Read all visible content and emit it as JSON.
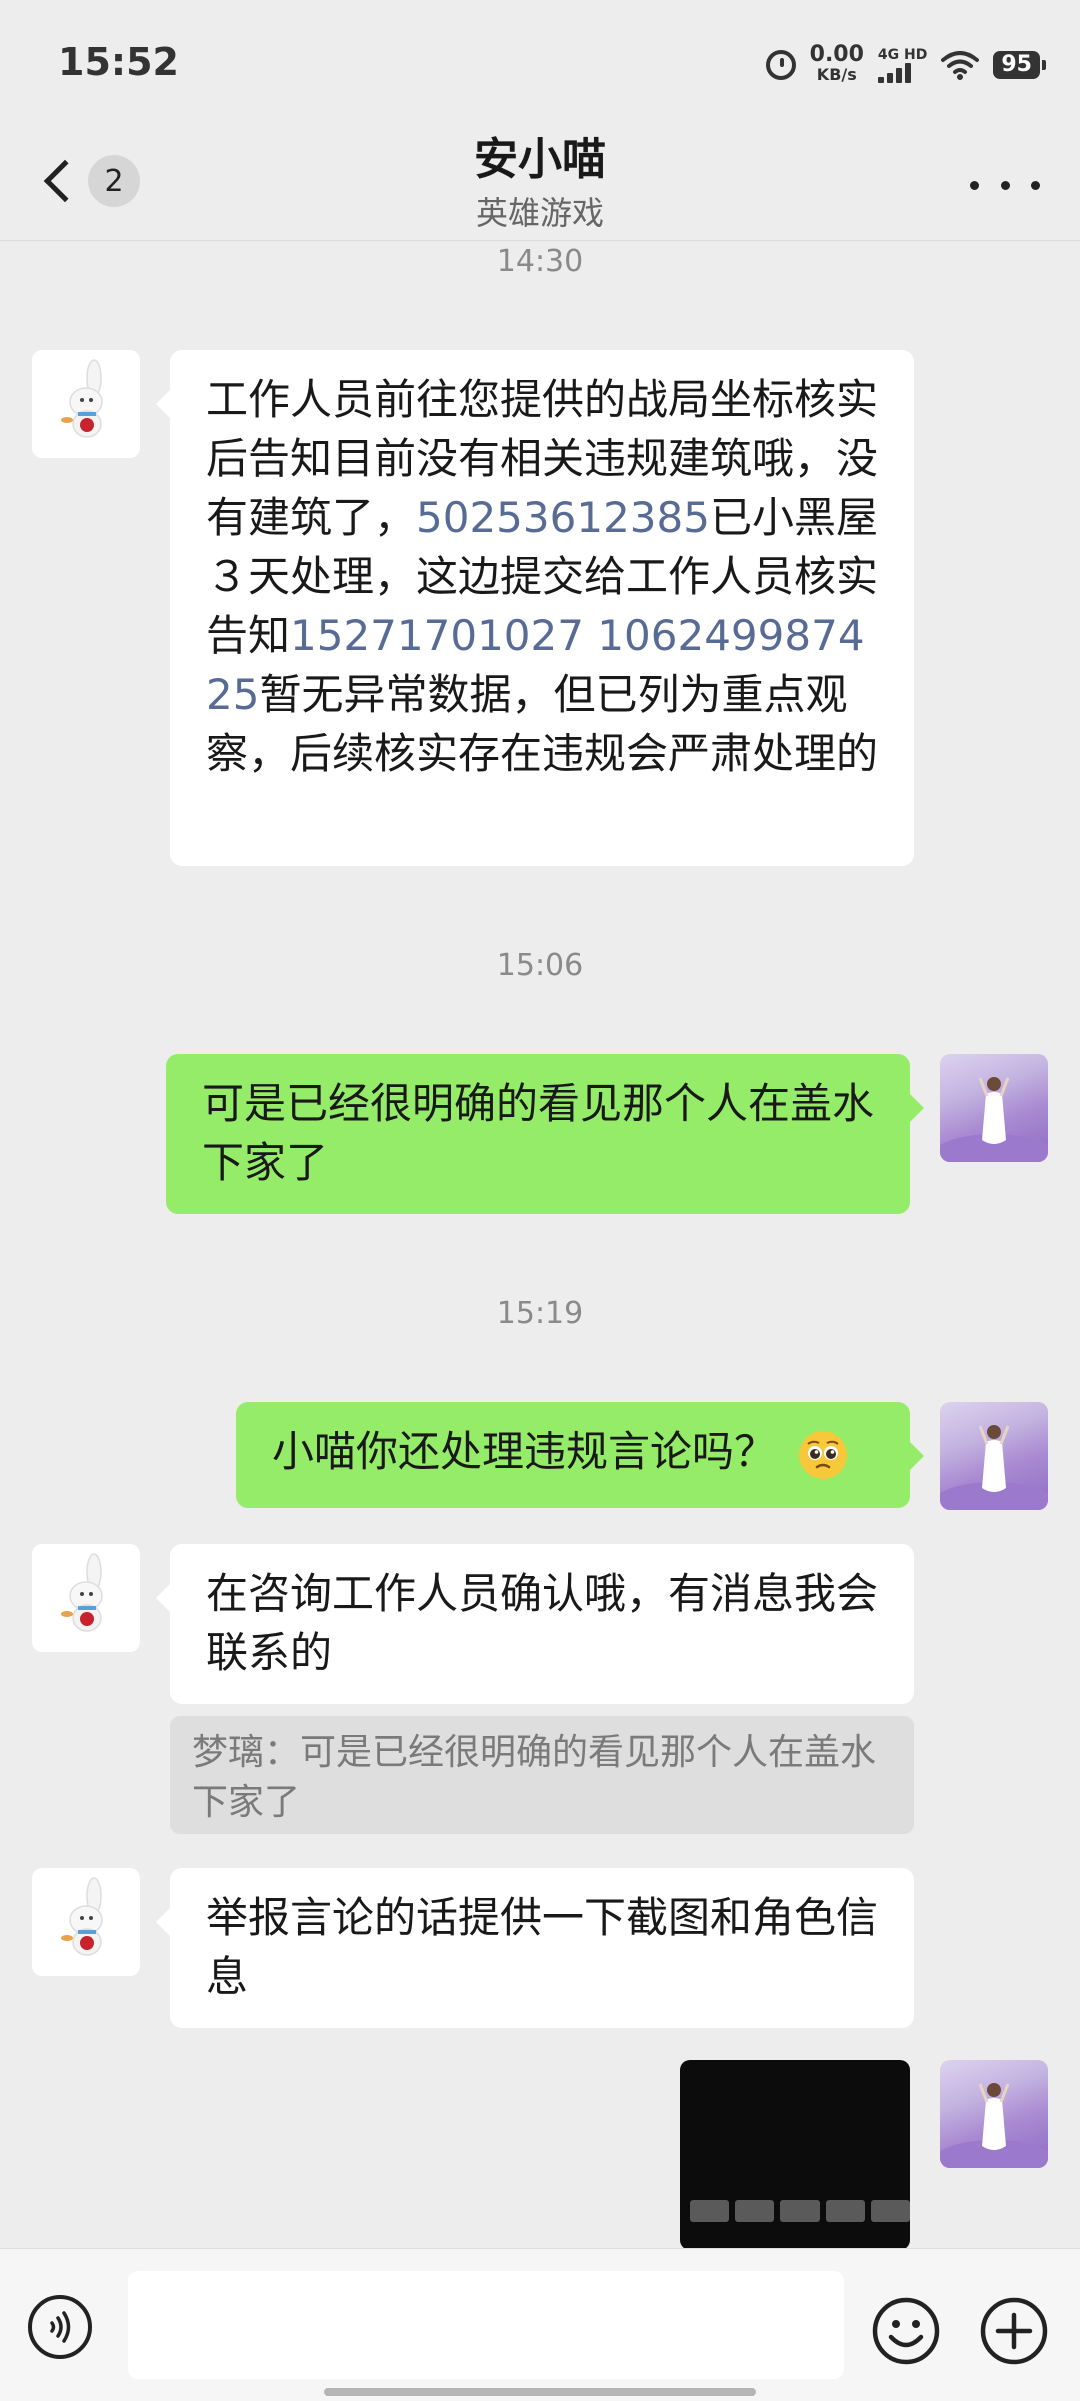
{
  "status_bar": {
    "time": "15:52",
    "net_speed": "0.00",
    "net_unit": "KB/s",
    "signal_label": "4G HD",
    "battery": "95"
  },
  "header": {
    "unread_count": "2",
    "title": "安小喵",
    "subtitle": "英雄游戏"
  },
  "messages": [
    {
      "timestamp": "14:30",
      "sender": "contact",
      "parts": [
        "工作人员前往您提供的战局坐标核实后告知目前没有相关违规建筑哦，没有建筑了，",
        "50253612385",
        "已小黑屋３天处理，这边提交给工作人员核实告知",
        "15271701027",
        " ",
        "106249987425",
        "暂无异常数据，但已列为重点观察，后续核实存在违规会严肃处理的"
      ]
    },
    {
      "timestamp": "15:06",
      "sender": "me",
      "text": "可是已经很明确的看见那个人在盖水下家了"
    },
    {
      "timestamp": "15:19",
      "sender": "me",
      "text": "小喵你还处理违规言论吗？"
    },
    {
      "sender": "contact",
      "text": "在咨询工作人员确认哦，有消息我会联系的",
      "quote": "梦璃：可是已经很明确的看见那个人在盖水下家了"
    },
    {
      "sender": "contact",
      "text": "举报言论的话提供一下截图和角色信息"
    }
  ],
  "input": {
    "placeholder": ""
  },
  "colors": {
    "background": "#ededed",
    "outgoing_bubble": "#95ec69",
    "incoming_bubble": "#ffffff",
    "link_number": "#576b95"
  },
  "icons": [
    "back-chevron-icon",
    "more-icon",
    "voice-icon",
    "emoji-icon",
    "plus-icon",
    "pleading-face-emoji"
  ]
}
